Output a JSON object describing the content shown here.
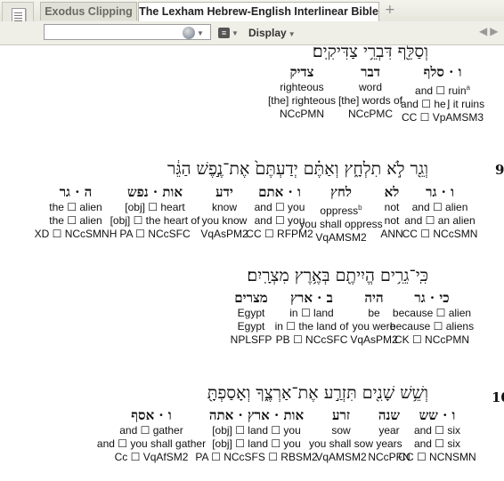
{
  "tabs": [
    {
      "label": "Exodus Clipping"
    },
    {
      "label": "The Lexham Hebrew-English Interlinear Bible"
    }
  ],
  "toolbar": {
    "reference_value": "",
    "display_label": "Display",
    "add_tab": "+"
  },
  "icons": {
    "app": "book-page-icon",
    "resource": "globe-icon",
    "visual_filter": "filter-icon",
    "nav_back": "arrow-left-icon",
    "nav_forward": "arrow-right-icon"
  },
  "lines": [
    {
      "hebrew": "וְסַלֵּ֖ף דִּבְרֵ֥י צַדִּיקִֽים׃",
      "verse": "",
      "words": [
        {
          "lemma": "ו · סלף",
          "g1": "and ☐ ruin",
          "sup": "a",
          "g2": "and ☐ he⌋ it ruins",
          "morph": "CC ☐ VpAMSM3"
        },
        {
          "lemma": "דבר",
          "g1": "word",
          "sup": "",
          "g2": "[the] words of",
          "morph": "NCcPMC"
        },
        {
          "lemma": "צדיק",
          "g1": "righteous",
          "sup": "",
          "g2": "[the] righteous",
          "morph": "NCcPMN"
        }
      ]
    },
    {
      "hebrew": "וְגֵ֖ר לֹ֣א תִלְחָ֑ץ וְאַתֶּ֗ם יְדַעְתֶּם֙ אֶת־נֶ֣פֶשׁ הַגֵּ֔ר",
      "verse": "9",
      "words": [
        {
          "lemma": "ו · גר",
          "g1": "and ☐ alien",
          "sup": "",
          "g2": "and ☐ an alien",
          "morph": "CC ☐ NCcSMN"
        },
        {
          "lemma": "לא",
          "g1": "not",
          "sup": "",
          "g2": "not",
          "morph": "ANN"
        },
        {
          "lemma": "לחץ",
          "g1": "oppress",
          "sup": "b",
          "g2": "you shall oppress",
          "morph": "VqAMSM2"
        },
        {
          "lemma": "ו · אתם",
          "g1": "and ☐ you",
          "sup": "",
          "g2": "and ☐ you",
          "morph": "CC ☐ RFPM2"
        },
        {
          "lemma": "ידע",
          "g1": "know",
          "sup": "",
          "g2": "you know",
          "morph": "VqAsPM2"
        },
        {
          "lemma": "אות · נפש",
          "g1": "[obj] ☐ heart",
          "sup": "",
          "g2": "[obj] ☐ the heart of",
          "morph": "PA ☐ NCcSFC"
        },
        {
          "lemma": "ה · גר",
          "g1": "the ☐ alien",
          "sup": "",
          "g2": "the ☐ alien",
          "morph": "XD ☐ NCcSMNH"
        }
      ]
    },
    {
      "hebrew": "כִּֽי־גֵרִ֥ים הֱיִיתֶ֖ם בְּאֶ֥רֶץ מִצְרָֽיִם׃",
      "verse": "",
      "words": [
        {
          "lemma": "כי · גר",
          "g1": "because ☐ alien",
          "sup": "",
          "g2": "because ☐ aliens",
          "morph": "CK ☐ NCcPMN"
        },
        {
          "lemma": "היה",
          "g1": "be",
          "sup": "",
          "g2": "you were",
          "morph": "VqAsPM2"
        },
        {
          "lemma": "ב · ארץ",
          "g1": "in ☐ land",
          "sup": "",
          "g2": "in ☐ the land of",
          "morph": "PB ☐ NCcSFC"
        },
        {
          "lemma": "מצרים",
          "g1": "Egypt",
          "sup": "",
          "g2": "Egypt",
          "morph": "NPLSFP"
        }
      ]
    },
    {
      "hebrew": "וְשֵׁ֥שׁ שָׁנִ֖ים תִּזְרַ֣ע אֶת־אַרְצֶ֑ךָ וְאָסַפְתָּ֖",
      "verse": "10",
      "words": [
        {
          "lemma": "ו · שש",
          "g1": "and ☐ six",
          "sup": "",
          "g2": "and ☐ six",
          "morph": "CC ☐ NCNSMN"
        },
        {
          "lemma": "שנה",
          "g1": "year",
          "sup": "",
          "g2": "years",
          "morph": "NCcPFN"
        },
        {
          "lemma": "זרע",
          "g1": "sow",
          "sup": "",
          "g2": "you shall sow",
          "morph": "VqAMSM2"
        },
        {
          "lemma": "אות · ארץ · אתה",
          "g1": "[obj] ☐ land ☐ you",
          "sup": "",
          "g2": "[obj] ☐ land ☐ you",
          "morph": "PA ☐ NCcSFS ☐ RBSM2"
        },
        {
          "lemma": "ו · אסף",
          "g1": "and ☐ gather",
          "sup": "",
          "g2": "and ☐ you shall gather",
          "morph": "Cc ☐ VqAfSM2"
        }
      ]
    }
  ]
}
